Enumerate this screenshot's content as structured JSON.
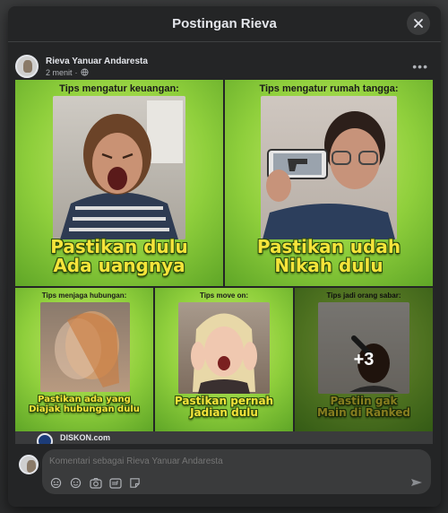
{
  "modal": {
    "title": "Postingan Rieva",
    "close_icon": "close-icon"
  },
  "post": {
    "author": "Rieva Yanuar Andaresta",
    "time": "2 menit",
    "audience_icon": "globe-icon",
    "more_icon": "more-horizontal-icon",
    "more_label": "•••"
  },
  "tiles": [
    {
      "top": "Tips mengatur keuangan:",
      "bottom_line1": "Pastikan dulu",
      "bottom_line2": "Ada uangnya"
    },
    {
      "top": "Tips mengatur rumah tangga:",
      "bottom_line1": "Pastikan udah",
      "bottom_line2": "Nikah dulu"
    },
    {
      "top": "Tips menjaga hubungan:",
      "bottom_line1": "Pastikan ada yang",
      "bottom_line2": "Diajak hubungan dulu"
    },
    {
      "top": "Tips move on:",
      "bottom_line1": "Pastikan pernah",
      "bottom_line2": "Jadian dulu"
    },
    {
      "top": "Tips jadi orang sabar:",
      "bottom_line1": "Pastiin gak",
      "bottom_line2": "Main di Ranked"
    }
  ],
  "more_photos": "+3",
  "link_preview": {
    "label": "DISKON.com"
  },
  "comment": {
    "placeholder": "Komentari sebagai Rieva Yanuar Andaresta",
    "tools": [
      "avatar-sticker-icon",
      "emoji-icon",
      "camera-icon",
      "gif-icon",
      "sticker-icon"
    ],
    "send_icon": "send-icon"
  },
  "colors": {
    "modal_bg": "#242526",
    "tile_green": "#8fcf3c",
    "caption_yellow": "#f5e43a"
  }
}
